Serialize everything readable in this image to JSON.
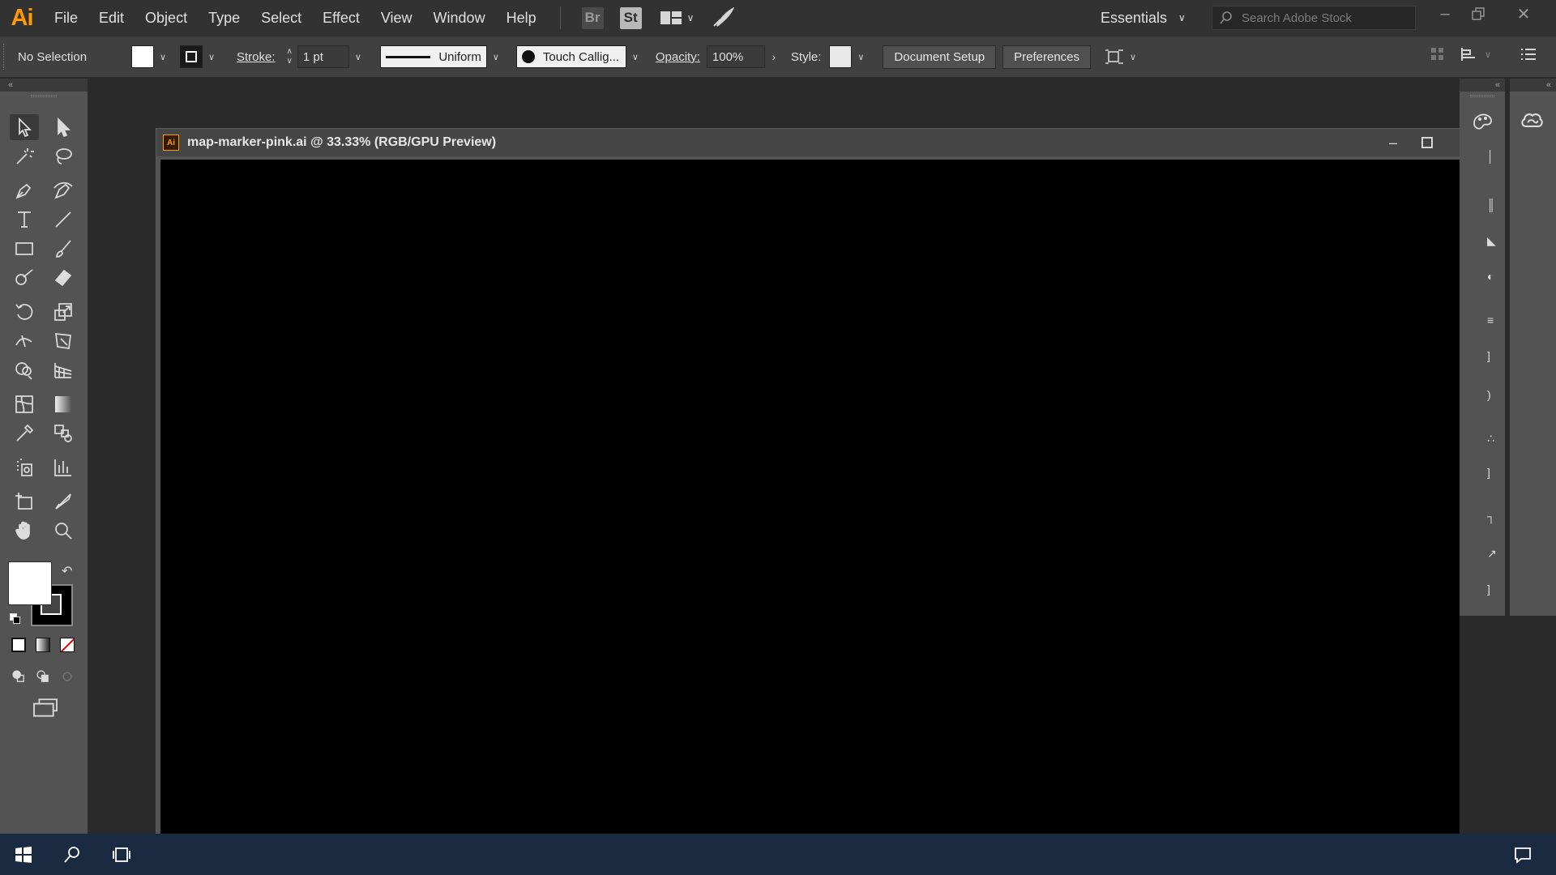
{
  "app": {
    "logo": "Ai",
    "name": "Adobe Illustrator"
  },
  "menu": {
    "items": [
      "File",
      "Edit",
      "Object",
      "Type",
      "Select",
      "Effect",
      "View",
      "Window",
      "Help"
    ]
  },
  "header": {
    "bridge_badge": "Br",
    "stock_badge": "St",
    "workspace": "Essentials",
    "search_placeholder": "Search Adobe Stock"
  },
  "control_bar": {
    "selection": "No Selection",
    "stroke_label": "Stroke:",
    "stroke_weight": "1 pt",
    "profile": "Uniform",
    "brush": "Touch Callig...",
    "opacity_label": "Opacity:",
    "opacity_value": "100%",
    "style_label": "Style:",
    "document_setup": "Document Setup",
    "preferences": "Preferences"
  },
  "document": {
    "title": "map-marker-pink.ai @ 33.33% (RGB/GPU Preview)",
    "icon": "Ai"
  },
  "colors": {
    "accent": "#ff9a00",
    "canvas": "#000000",
    "panel": "#535353",
    "menubar": "#323232"
  },
  "icons": {
    "tools": [
      "selection-tool-icon",
      "direct-selection-tool-icon",
      "magic-wand-tool-icon",
      "lasso-tool-icon",
      "pen-tool-icon",
      "curvature-tool-icon",
      "type-tool-icon",
      "line-segment-tool-icon",
      "rectangle-tool-icon",
      "paintbrush-tool-icon",
      "shaper-tool-icon",
      "eraser-tool-icon",
      "rotate-tool-icon",
      "scale-tool-icon",
      "width-tool-icon",
      "free-transform-tool-icon",
      "shape-builder-tool-icon",
      "perspective-grid-tool-icon",
      "mesh-tool-icon",
      "gradient-tool-icon",
      "eyedropper-tool-icon",
      "blend-tool-icon",
      "symbol-sprayer-tool-icon",
      "column-graph-tool-icon",
      "artboard-tool-icon",
      "slice-tool-icon",
      "hand-tool-icon",
      "zoom-tool-icon"
    ]
  }
}
